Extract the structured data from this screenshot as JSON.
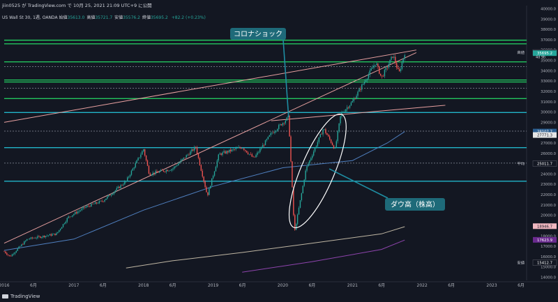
{
  "header": {
    "publish_line": "jiin0525 が TradingView.com で 10月 25, 2021 21:09 UTC+9 に公開",
    "symbol": "US Wall St 30, 1週, OANDA",
    "ohlc": [
      {
        "label": "始値",
        "value": "35613.0"
      },
      {
        "label": "高値",
        "value": "35721.7"
      },
      {
        "label": "安値",
        "value": "35576.2"
      },
      {
        "label": "終値",
        "value": "35695.2"
      }
    ],
    "change": "+82.2 (+0.23%)"
  },
  "footer": {
    "brand": "TradingView"
  },
  "colors": {
    "background": "#131722",
    "up": "#26a69a",
    "down": "#ef5350",
    "green_line": "#22c55e",
    "cyan_line": "#22b5c9",
    "trend_line": "#e8a0a0",
    "ma_blue": "#4f7fbf",
    "ma_beige": "#bfb6a3",
    "ma_purple": "#8e44ad",
    "annotation_bg": "#1e6a79"
  },
  "chart_data": {
    "type": "candlestick",
    "title": "",
    "x_tick_labels": [
      "2016",
      "6月",
      "2017",
      "6月",
      "2018",
      "6月",
      "2019",
      "6月",
      "2020",
      "6月",
      "2021",
      "6月",
      "2022",
      "6月",
      "2023",
      "6月"
    ],
    "y_tick_labels": [
      "40000.0",
      "39000.0",
      "38000.0",
      "37000.0",
      "36000.0",
      "35000.0",
      "34000.0",
      "33000.0",
      "32000.0",
      "31000.0",
      "30000.0",
      "29000.0",
      "28000.0",
      "27000.0",
      "26000.0",
      "25000.0",
      "24000.0",
      "23000.0",
      "22000.0",
      "21000.0",
      "20000.0",
      "19000.0",
      "18000.0",
      "17000.0",
      "16000.0",
      "15000.0",
      "14000.0"
    ],
    "ylim": [
      13700,
      40300
    ],
    "price_path": [
      [
        "2016-01",
        16500
      ],
      [
        "2016-02",
        16000
      ],
      [
        "2016-05",
        17700
      ],
      [
        "2016-10",
        18200
      ],
      [
        "2016-12",
        19800
      ],
      [
        "2017-03",
        20800
      ],
      [
        "2017-06",
        21400
      ],
      [
        "2017-10",
        23300
      ],
      [
        "2018-01",
        26400
      ],
      [
        "2018-02",
        24000
      ],
      [
        "2018-06",
        24500
      ],
      [
        "2018-10",
        26600
      ],
      [
        "2018-12",
        21900
      ],
      [
        "2019-02",
        25900
      ],
      [
        "2019-06",
        26600
      ],
      [
        "2019-08",
        25500
      ],
      [
        "2019-11",
        27900
      ],
      [
        "2020-02",
        29500
      ],
      [
        "2020-03",
        18300
      ],
      [
        "2020-05",
        24500
      ],
      [
        "2020-08",
        28400
      ],
      [
        "2020-10",
        26400
      ],
      [
        "2020-11",
        29800
      ],
      [
        "2021-01",
        31000
      ],
      [
        "2021-03",
        32900
      ],
      [
        "2021-05",
        34800
      ],
      [
        "2021-06",
        33300
      ],
      [
        "2021-08",
        35500
      ],
      [
        "2021-09",
        33700
      ],
      [
        "2021-10",
        35700
      ]
    ],
    "horizontal_levels": [
      {
        "value": 36950,
        "color": "#22c55e"
      },
      {
        "value": 36600,
        "color": "#22c55e"
      },
      {
        "value": 34850,
        "color": "#22c55e"
      },
      {
        "value": 33100,
        "color": "#22c55e"
      },
      {
        "value": 32900,
        "color": "#22c55e"
      },
      {
        "value": 31300,
        "color": "#22c55e"
      },
      {
        "value": 29950,
        "color": "#22b5c9"
      },
      {
        "value": 26550,
        "color": "#22b5c9"
      },
      {
        "value": 23300,
        "color": "#22b5c9"
      }
    ],
    "dashed_levels": [
      34400,
      32300,
      28150,
      25050
    ],
    "trendlines": [
      {
        "from": [
          "2016-01",
          29000
        ],
        "to": [
          "2021-12",
          36000
        ],
        "color": "#e8a0a0"
      },
      {
        "from": [
          "2016-01",
          17300
        ],
        "to": [
          "2021-12",
          35750
        ],
        "color": "#e8a0a0"
      },
      {
        "from": [
          "2019-11",
          29150
        ],
        "to": [
          "2022-05",
          30650
        ],
        "color": "#e8a0a0"
      }
    ],
    "moving_averages": [
      {
        "color": "#4f7fbf",
        "points": [
          [
            "2016-01",
            16600
          ],
          [
            "2017-01",
            17700
          ],
          [
            "2018-01",
            20500
          ],
          [
            "2019-01",
            22800
          ],
          [
            "2020-01",
            24600
          ],
          [
            "2021-01",
            25300
          ],
          [
            "2021-07",
            27000
          ],
          [
            "2021-10",
            28100
          ]
        ]
      },
      {
        "color": "#bfb6a3",
        "points": [
          [
            "2017-10",
            14900
          ],
          [
            "2018-06",
            15600
          ],
          [
            "2019-06",
            16400
          ],
          [
            "2020-06",
            17300
          ],
          [
            "2021-06",
            18200
          ],
          [
            "2021-10",
            18900
          ]
        ]
      },
      {
        "color": "#8e44ad",
        "points": [
          [
            "2019-06",
            14500
          ],
          [
            "2020-06",
            15500
          ],
          [
            "2021-06",
            16700
          ],
          [
            "2021-10",
            17600
          ]
        ]
      }
    ],
    "price_labels": [
      {
        "text": "高値",
        "value": 35769.2,
        "style": "plain"
      },
      {
        "text": "35769.2",
        "value": 35769.2,
        "style": "box",
        "color": "#131722"
      },
      {
        "text": "35695.2",
        "value": 35695.2,
        "style": "box",
        "color": "#26a69a"
      },
      {
        "text": "4d 9h",
        "value": 35350,
        "style": "sub"
      },
      {
        "text": "28107.7",
        "value": 28107.7,
        "style": "box",
        "color": "#2a5d8f"
      },
      {
        "text": "27771.3",
        "value": 27771.3,
        "style": "box",
        "color": "#e6e6e6"
      },
      {
        "text": "平均",
        "value": 25011.7,
        "style": "plain"
      },
      {
        "text": "25011.7",
        "value": 25011.7,
        "style": "box",
        "color": "#131722"
      },
      {
        "text": "18946.7",
        "value": 18946.7,
        "style": "box",
        "color": "#f0b7c0"
      },
      {
        "text": "17623.9",
        "value": 17623.9,
        "style": "box",
        "color": "#6a2a8f"
      },
      {
        "text": "安値",
        "value": 15412.7,
        "style": "plain"
      },
      {
        "text": "15412.7",
        "value": 15412.7,
        "style": "box",
        "color": "#131722"
      }
    ],
    "annotations": [
      {
        "text": "コロナショック",
        "arrow_to": [
          "2020-02",
          29500
        ]
      },
      {
        "text": "ダウ高（株高）",
        "arrow_to": [
          "2020-09",
          24500
        ]
      }
    ]
  }
}
